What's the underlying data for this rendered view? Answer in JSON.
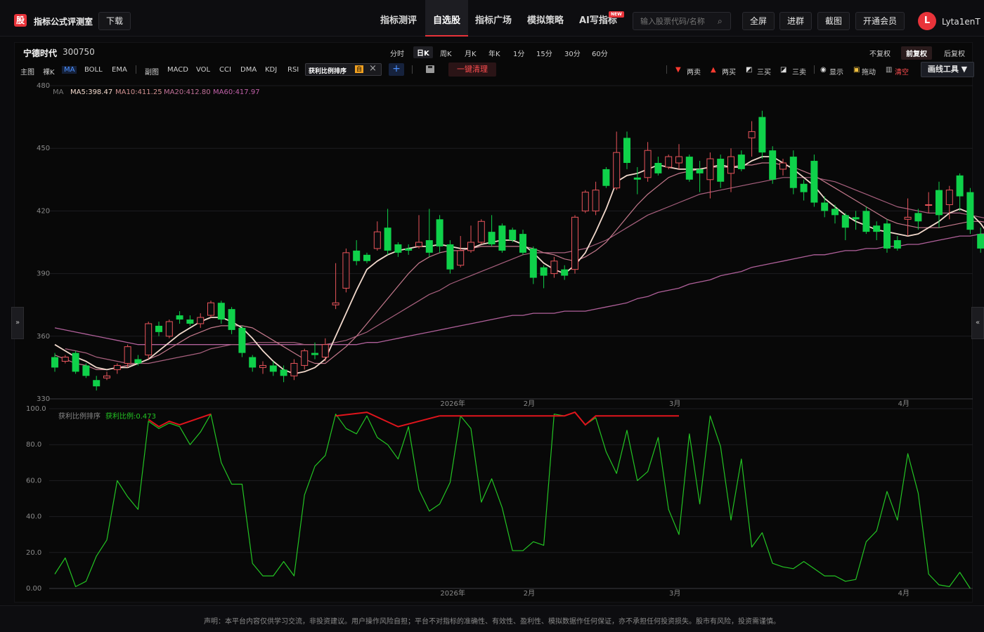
{
  "app": {
    "logo_char": "股",
    "title": "指标公式评测室",
    "download_label": "下载",
    "nav": [
      {
        "label": "指标测评"
      },
      {
        "label": "自选股",
        "active": true
      },
      {
        "label": "指标广场"
      },
      {
        "label": "模拟策略"
      },
      {
        "label": "AI写指标"
      }
    ],
    "new_badge": "NEW",
    "search_placeholder": "输入股票代码/名称",
    "fullscreen_label": "全屏",
    "join_group_label": "进群",
    "screenshot_label": "截图",
    "vip_label": "开通会员",
    "avatar_letter": "L",
    "username": "Lyta1enT"
  },
  "stock": {
    "name": "宁德时代",
    "code": "300750"
  },
  "periods": [
    "分时",
    "日K",
    "周K",
    "月K",
    "年K",
    "1分",
    "15分",
    "30分",
    "60分"
  ],
  "active_period": "日K",
  "adjust": [
    {
      "label": "不复权"
    },
    {
      "label": "前复权",
      "active": true
    },
    {
      "label": "后复权"
    }
  ],
  "toolbar": {
    "main_label": "主图",
    "naked_k": "裸K",
    "main_items": [
      "MA",
      "BOLL",
      "EMA"
    ],
    "sub_label": "副图",
    "sub_items": [
      "MACD",
      "VOL",
      "CCI",
      "DMA",
      "KDJ",
      "RSI"
    ],
    "indicator_tag": "获利比例排序",
    "indicator_self": "自",
    "plus": "+",
    "clear_label": "一键清理",
    "right": {
      "two_sell": "两卖",
      "two_buy": "两买",
      "three_buy": "三买",
      "three_sell": "三卖",
      "show": "显示",
      "drag": "拖动",
      "clear": "清空"
    },
    "draw_tool": "画线工具 ▼"
  },
  "legend": {
    "ma_label": "MA",
    "ma5": "MA5:398.47",
    "ma10": "MA10:411.25",
    "ma20": "MA20:412.80",
    "ma60": "MA60:417.97"
  },
  "sub_legend": {
    "name": "获利比例排序",
    "value": "获利比例:0.473"
  },
  "colors": {
    "up": "#e8545a",
    "down": "#0fd14a",
    "ma5": "#f2d9cc",
    "ma10": "#c4798c",
    "ma20": "#a8607e",
    "ma60": "#b0609a",
    "profit_line": "#23c423",
    "top_line": "#e0141c"
  },
  "footer": {
    "disclaimer": "声明：本平台内容仅供学习交流，非投资建议。用户操作风险自担；平台不对指标的准确性、有效性、盈利性、模拟数据作任何保证，亦不承担任何投资损失。股市有风险，投资需谨慎。"
  },
  "chart_data": [
    {
      "type": "candlestick",
      "ylim": [
        330,
        480
      ],
      "y_ticks": [
        "480",
        "450",
        "420",
        "390",
        "360",
        "330"
      ],
      "x_tick_labels": [
        "2026年",
        "2月",
        "3月",
        "4月"
      ],
      "x_tick_index": [
        38,
        46,
        60,
        82
      ],
      "candles": [
        [
          350,
          345,
          352,
          343
        ],
        [
          348,
          350,
          351,
          347
        ],
        [
          352,
          343,
          353,
          342
        ],
        [
          346,
          341,
          347,
          340
        ],
        [
          339,
          336,
          341,
          334
        ],
        [
          340,
          341,
          343,
          339
        ],
        [
          344,
          346,
          347,
          342
        ],
        [
          347,
          355,
          356,
          345
        ],
        [
          349,
          347,
          351,
          346
        ],
        [
          351,
          366,
          367,
          349
        ],
        [
          365,
          362,
          367,
          360
        ],
        [
          360,
          367,
          368,
          359
        ],
        [
          370,
          368,
          372,
          366
        ],
        [
          368,
          366,
          370,
          365
        ],
        [
          366,
          369,
          371,
          364
        ],
        [
          370,
          376,
          377,
          369
        ],
        [
          376,
          368,
          377,
          366
        ],
        [
          373,
          363,
          374,
          361
        ],
        [
          364,
          352,
          365,
          350
        ],
        [
          350,
          345,
          351,
          343
        ],
        [
          345,
          346,
          348,
          342
        ],
        [
          346,
          343,
          348,
          341
        ],
        [
          344,
          341,
          346,
          338
        ],
        [
          341,
          347,
          349,
          339
        ],
        [
          346,
          353,
          354,
          344
        ],
        [
          352,
          351,
          357,
          349
        ],
        [
          350,
          356,
          359,
          348
        ],
        [
          375,
          376,
          395,
          373
        ],
        [
          383,
          400,
          402,
          381
        ],
        [
          401,
          396,
          406,
          394
        ],
        [
          399,
          396,
          400,
          395
        ],
        [
          402,
          410,
          415,
          401
        ],
        [
          412,
          401,
          421,
          399
        ],
        [
          404,
          400,
          405,
          398
        ],
        [
          402,
          401,
          404,
          399
        ],
        [
          403,
          405,
          418,
          402
        ],
        [
          406,
          400,
          421,
          398
        ],
        [
          416,
          403,
          418,
          400
        ],
        [
          404,
          392,
          406,
          390
        ],
        [
          394,
          401,
          408,
          393
        ],
        [
          401,
          405,
          413,
          400
        ],
        [
          405,
          415,
          416,
          404
        ],
        [
          410,
          404,
          418,
          403
        ],
        [
          413,
          401,
          414,
          400
        ],
        [
          411,
          406,
          412,
          405
        ],
        [
          409,
          400,
          411,
          399
        ],
        [
          402,
          388,
          403,
          385
        ],
        [
          393,
          389,
          394,
          383
        ],
        [
          390,
          396,
          398,
          388
        ],
        [
          392,
          389,
          394,
          387
        ],
        [
          392,
          417,
          418,
          390
        ],
        [
          420,
          429,
          430,
          419
        ],
        [
          420,
          430,
          434,
          418
        ],
        [
          440,
          432,
          441,
          431
        ],
        [
          431,
          448,
          458,
          430
        ],
        [
          455,
          443,
          458,
          440
        ],
        [
          436,
          435,
          441,
          428
        ],
        [
          436,
          449,
          453,
          434
        ],
        [
          443,
          438,
          446,
          437
        ],
        [
          441,
          446,
          447,
          440
        ],
        [
          443,
          446,
          452,
          440
        ],
        [
          446,
          435,
          447,
          434
        ],
        [
          440,
          438,
          444,
          429
        ],
        [
          435,
          445,
          448,
          426
        ],
        [
          445,
          434,
          447,
          431
        ],
        [
          438,
          446,
          450,
          429
        ],
        [
          447,
          440,
          449,
          439
        ],
        [
          455,
          458,
          463,
          446
        ],
        [
          465,
          448,
          468,
          445
        ],
        [
          449,
          435,
          451,
          433
        ],
        [
          440,
          443,
          445,
          437
        ],
        [
          446,
          431,
          449,
          428
        ],
        [
          433,
          429,
          435,
          425
        ],
        [
          444,
          424,
          447,
          422
        ],
        [
          424,
          420,
          427,
          417
        ],
        [
          421,
          418,
          423,
          414
        ],
        [
          418,
          412,
          419,
          406
        ],
        [
          417,
          416,
          420,
          411
        ],
        [
          420,
          410,
          422,
          409
        ],
        [
          413,
          410,
          415,
          406
        ],
        [
          414,
          402,
          416,
          400
        ],
        [
          406,
          402,
          408,
          401
        ],
        [
          416,
          417,
          426,
          408
        ],
        [
          419,
          415,
          421,
          411
        ],
        [
          423,
          423,
          429,
          419
        ],
        [
          430,
          418,
          434,
          412
        ],
        [
          423,
          430,
          432,
          416
        ],
        [
          437,
          427,
          438,
          420
        ],
        [
          429,
          411,
          431,
          409
        ],
        [
          409,
          402,
          412,
          400
        ],
        [
          394,
          391,
          400,
          390
        ],
        [
          398,
          399,
          404,
          392
        ],
        [
          395,
          389,
          396,
          388
        ]
      ],
      "ma5": [
        356,
        353,
        350,
        348,
        345,
        344,
        345,
        345,
        347,
        349,
        353,
        357,
        361,
        364,
        367,
        369,
        369,
        367,
        364,
        359,
        353,
        348,
        344,
        342,
        343,
        345,
        349,
        360,
        371,
        382,
        392,
        396,
        399,
        401,
        402,
        403,
        403,
        404,
        403,
        402,
        402,
        404,
        405,
        406,
        406,
        404,
        400,
        395,
        392,
        390,
        394,
        400,
        410,
        421,
        434,
        437,
        438,
        440,
        442,
        441,
        440,
        440,
        440,
        441,
        442,
        441,
        441,
        444,
        446,
        446,
        443,
        440,
        436,
        432,
        426,
        422,
        418,
        415,
        413,
        411,
        410,
        409,
        408,
        409,
        412,
        415,
        419,
        421,
        419,
        414,
        407,
        402,
        398
      ],
      "ma10": [
        351,
        349,
        347,
        346,
        344,
        344,
        345,
        346,
        347,
        349,
        351,
        354,
        357,
        360,
        362,
        364,
        365,
        365,
        365,
        364,
        361,
        358,
        355,
        352,
        349,
        347,
        347,
        351,
        355,
        360,
        366,
        372,
        378,
        384,
        390,
        395,
        398,
        400,
        401,
        401,
        402,
        403,
        403,
        403,
        403,
        403,
        402,
        400,
        399,
        397,
        396,
        398,
        401,
        405,
        411,
        417,
        423,
        428,
        432,
        436,
        438,
        439,
        440,
        441,
        441,
        441,
        442,
        442,
        443,
        443,
        442,
        441,
        439,
        437,
        434,
        431,
        428,
        425,
        422,
        419,
        416,
        414,
        413,
        412,
        412,
        412,
        413,
        414,
        415,
        415,
        414,
        412,
        410
      ],
      "ma20": [
        null,
        354,
        353,
        352,
        350,
        349,
        348,
        347,
        347,
        347,
        348,
        349,
        350,
        351,
        352,
        354,
        355,
        356,
        356,
        357,
        357,
        357,
        357,
        357,
        356,
        356,
        356,
        357,
        358,
        360,
        362,
        365,
        368,
        371,
        374,
        377,
        380,
        382,
        385,
        387,
        389,
        391,
        393,
        395,
        397,
        399,
        400,
        400,
        400,
        400,
        401,
        402,
        404,
        406,
        409,
        412,
        415,
        418,
        420,
        422,
        424,
        426,
        428,
        429,
        430,
        431,
        432,
        433,
        434,
        435,
        436,
        436,
        436,
        436,
        435,
        434,
        432,
        430,
        428,
        426,
        424,
        422,
        421,
        420,
        419,
        419,
        419,
        419,
        418,
        417,
        416,
        415,
        413
      ],
      "ma60": [
        364,
        363,
        362,
        361,
        360,
        359,
        358,
        357,
        356,
        356,
        356,
        356,
        356,
        356,
        356,
        356,
        356,
        356,
        356,
        356,
        356,
        356,
        356,
        356,
        356,
        356,
        356,
        356,
        356,
        356,
        357,
        357,
        358,
        359,
        360,
        361,
        362,
        363,
        364,
        365,
        366,
        367,
        368,
        369,
        370,
        370,
        371,
        371,
        371,
        372,
        372,
        372,
        373,
        374,
        375,
        376,
        378,
        379,
        381,
        382,
        383,
        385,
        386,
        387,
        389,
        390,
        391,
        393,
        394,
        395,
        396,
        397,
        398,
        399,
        399,
        400,
        401,
        401,
        402,
        402,
        403,
        403,
        404,
        404,
        405,
        406,
        407,
        408,
        408,
        409,
        409,
        409,
        409
      ]
    },
    {
      "type": "line",
      "ylim": [
        0,
        100
      ],
      "y_ticks": [
        "100.0",
        "80.0",
        "60.0",
        "40.0",
        "20.0",
        "0.00"
      ],
      "x_tick_labels": [
        "2026年",
        "2月",
        "3月",
        "4月"
      ],
      "x_tick_index": [
        38,
        46,
        60,
        82
      ],
      "series": [
        {
          "name": "获利比例",
          "values": [
            8,
            17,
            1,
            4,
            18,
            27,
            60,
            51,
            44,
            93,
            89,
            92,
            90,
            80,
            87,
            97,
            70,
            58,
            58,
            14,
            7,
            7,
            15,
            7,
            52,
            68,
            74,
            97,
            89,
            86,
            96,
            84,
            80,
            72,
            90,
            55,
            43,
            47,
            59,
            96,
            89,
            48,
            61,
            45,
            21,
            21,
            26,
            24,
            97,
            96,
            98,
            91,
            95,
            76,
            64,
            88,
            60,
            65,
            84,
            44,
            30,
            86,
            47,
            96,
            79,
            38,
            72,
            23,
            31,
            14,
            12,
            11,
            15,
            11,
            7,
            7,
            4,
            5,
            26,
            32,
            54,
            38,
            75,
            53,
            8,
            2,
            1,
            9,
            0
          ]
        }
      ],
      "top_line_segments": [
        [
          [
            9,
            94
          ],
          [
            10,
            90
          ],
          [
            11,
            93
          ],
          [
            12,
            91
          ],
          [
            15,
            97
          ]
        ],
        [
          [
            27,
            96
          ],
          [
            30,
            98
          ],
          [
            33,
            90
          ],
          [
            37,
            96
          ]
        ],
        [
          [
            37,
            96
          ],
          [
            48,
            96
          ],
          [
            49,
            96
          ],
          [
            50,
            98
          ],
          [
            51,
            91
          ],
          [
            52,
            96
          ],
          [
            60,
            96
          ]
        ]
      ]
    }
  ]
}
